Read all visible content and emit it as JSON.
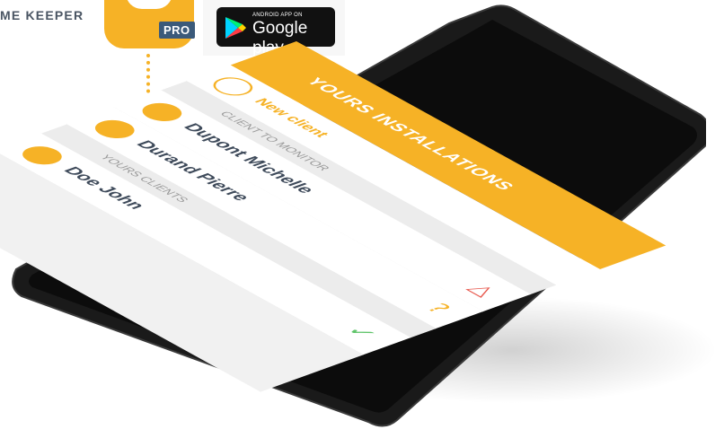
{
  "brand": {
    "text": "ME KEEPER",
    "badge": "PRO"
  },
  "store": {
    "small": "ANDROID APP ON",
    "big": "Google play"
  },
  "app": {
    "header_title": "YOURS INSTALLATIONS",
    "new_client": "New client",
    "section_monitor": "CLIENT TO MONITOR",
    "section_clients": "YOURS CLIENTS",
    "clients": [
      {
        "name": "Dupont Michelle",
        "status": "warning"
      },
      {
        "name": "Durand Pierre",
        "status": "unknown"
      },
      {
        "name": "Doe John",
        "status": "ok"
      }
    ]
  },
  "colors": {
    "accent": "#f6b226",
    "text": "#3e4a5a",
    "badge": "#3b5a7a"
  }
}
